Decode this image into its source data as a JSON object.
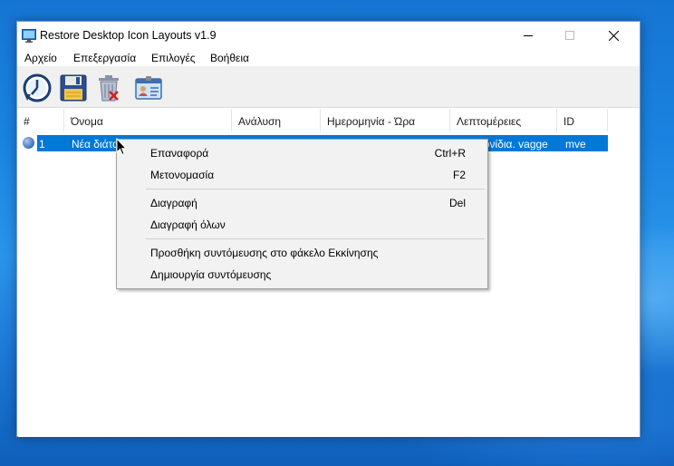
{
  "window": {
    "title": "Restore Desktop Icon Layouts v1.9"
  },
  "menubar": {
    "items": [
      "Αρχείο",
      "Επεξεργασία",
      "Επιλογές",
      "Βοήθεια"
    ]
  },
  "toolbar": {
    "buttons": [
      "restore-clock-icon",
      "save-floppy-icon",
      "delete-trash-icon",
      "properties-id-card-icon"
    ]
  },
  "list": {
    "columns": [
      "#",
      "Όνομα",
      "Ανάλυση",
      "Ημερομηνία - Ώρα",
      "Λεπτομέρειες",
      "ID"
    ],
    "rows": [
      {
        "index": "1",
        "name": "Νέα διάτα",
        "details": "κονίδια. vagge",
        "id": "mve",
        "selected": true
      }
    ]
  },
  "context_menu": {
    "items": [
      {
        "label": "Επαναφορά",
        "shortcut": "Ctrl+R"
      },
      {
        "label": "Μετονομασία",
        "shortcut": "F2"
      },
      {
        "label": "Διαγραφή",
        "shortcut": "Del"
      },
      {
        "label": "Διαγραφή όλων",
        "shortcut": ""
      },
      {
        "label": "Προσθήκη συντόμευσης στο φάκελο Εκκίνησης",
        "shortcut": ""
      },
      {
        "label": "Δημιουργία συντόμευσης",
        "shortcut": ""
      }
    ]
  },
  "colors": {
    "selection": "#0078d7",
    "menu_background": "#f2f2f2"
  }
}
